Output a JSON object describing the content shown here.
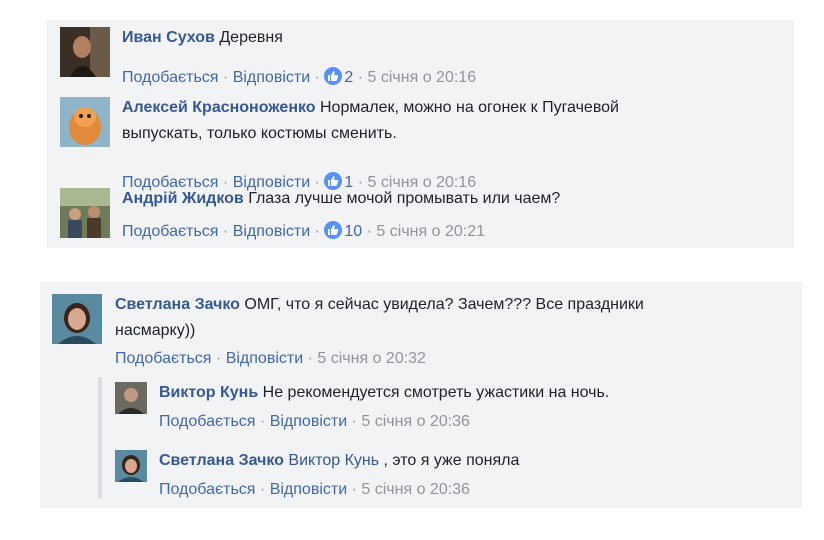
{
  "sep": "·",
  "thread1": {
    "comments": [
      {
        "author": "Иван Сухов",
        "text": "Деревня",
        "like": "Подобається",
        "reply": "Відповісти",
        "likes": "2",
        "time": "5 січня о 20:16"
      },
      {
        "author": "Алексей Красноноженко",
        "text_line1": "Нормалек, можно на огонек к Пугачевой",
        "text_line2": "выпускать, только костюмы сменить.",
        "like": "Подобається",
        "reply": "Відповісти",
        "likes": "1",
        "time": "5 січня о 20:16"
      },
      {
        "author": "Андрій Жидков",
        "text": "Глаза лучше мочой промывать или чаем?",
        "like": "Подобається",
        "reply": "Відповісти",
        "likes": "10",
        "time": "5 січня о 20:21"
      }
    ]
  },
  "thread2": {
    "main": {
      "author": "Светлана Зачко",
      "text_line1": "ОМГ, что я сейчас увидела? Зачем??? Все праздники",
      "text_line2": "насмарку))",
      "like": "Подобається",
      "reply": "Відповісти",
      "time": "5 січня о 20:32"
    },
    "replies": [
      {
        "author": "Виктор Кунь",
        "text": "Не рекомендуется смотреть ужастики на ночь.",
        "like": "Подобається",
        "reply": "Відповісти",
        "time": "5 січня о 20:36"
      },
      {
        "author": "Светлана Зачко",
        "mention": "Виктор Кунь",
        "text": ", это я уже поняла",
        "like": "Подобається",
        "reply": "Відповісти",
        "time": "5 січня о 20:36"
      }
    ]
  },
  "colors": {
    "author": "#365899",
    "link": "#4267b2",
    "meta": "#90949c",
    "panel": "#f2f3f5",
    "like_badge": "#5890ff"
  }
}
